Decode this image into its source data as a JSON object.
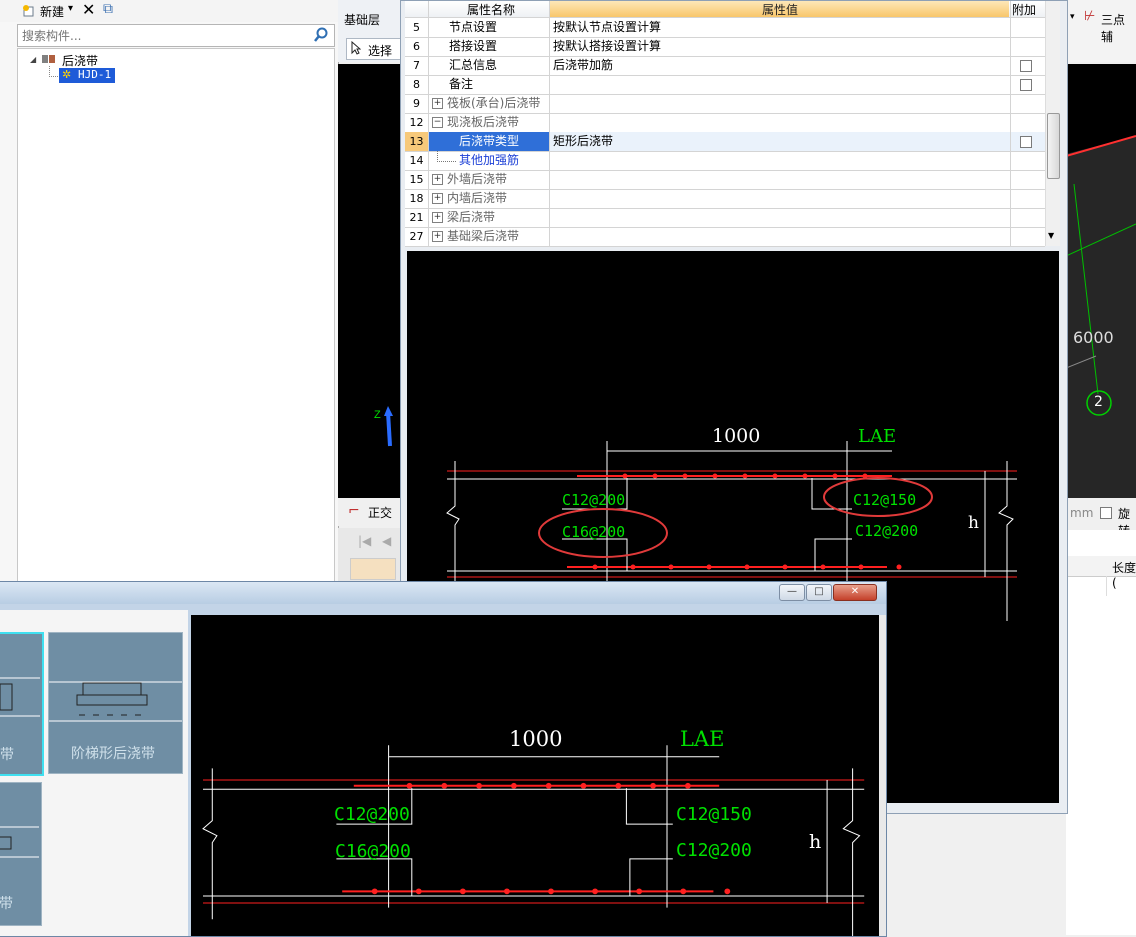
{
  "toolbar": {
    "new_label": "新建",
    "new_arrow": "▾",
    "delete_icon": "✕",
    "copy_icon": "⧉"
  },
  "search": {
    "placeholder": "搜索构件..."
  },
  "tree": {
    "root_label": "后浇带",
    "child_label": "HJD-1"
  },
  "layer": {
    "label": "基础层",
    "select_label": "选择",
    "ortho_label": "正交"
  },
  "props": {
    "header_name": "属性名称",
    "header_value": "属性值",
    "header_extra": "附加",
    "rows": [
      {
        "num": "5",
        "name": "节点设置",
        "value": "按默认节点设置计算"
      },
      {
        "num": "6",
        "name": "搭接设置",
        "value": "按默认搭接设置计算"
      },
      {
        "num": "7",
        "name": "汇总信息",
        "value": "后浇带加筋"
      },
      {
        "num": "8",
        "name": "备注",
        "value": ""
      },
      {
        "num": "9",
        "name": "筏板(承台)后浇带",
        "value": ""
      },
      {
        "num": "12",
        "name": "现浇板后浇带",
        "value": ""
      },
      {
        "num": "13",
        "name": "后浇带类型",
        "value": "矩形后浇带"
      },
      {
        "num": "14",
        "name": "其他加强筋",
        "value": ""
      },
      {
        "num": "15",
        "name": "外墙后浇带",
        "value": ""
      },
      {
        "num": "18",
        "name": "内墙后浇带",
        "value": ""
      },
      {
        "num": "21",
        "name": "梁后浇带",
        "value": ""
      },
      {
        "num": "27",
        "name": "基础梁后浇带",
        "value": ""
      }
    ]
  },
  "drawing_top": {
    "dim_1000": "1000",
    "dim_lae": "LAE",
    "c12_200_top": "C12@200",
    "c16_200": "C16@200",
    "c12_150": "C12@150",
    "c12_200_bottom": "C12@200",
    "h": "h"
  },
  "drawing_bottom": {
    "dim_1000": "1000",
    "dim_lae": "LAE",
    "c12_200_top": "C12@200",
    "c16_200": "C16@200",
    "c12_150": "C12@150",
    "c12_200_bottom": "C12@200",
    "h": "h"
  },
  "right_panel": {
    "three_point_label": "三点辅",
    "dim_6000": "6000",
    "axis_2": "2",
    "mm_label": "mm",
    "rotate_label": "旋转",
    "length_header": "长度("
  },
  "dialog": {
    "card_label_partial": "带",
    "card_label_step": "阶梯形后浇带",
    "card_label_partial2": "带",
    "minimize": "—",
    "maximize": "□",
    "close": "✕"
  }
}
